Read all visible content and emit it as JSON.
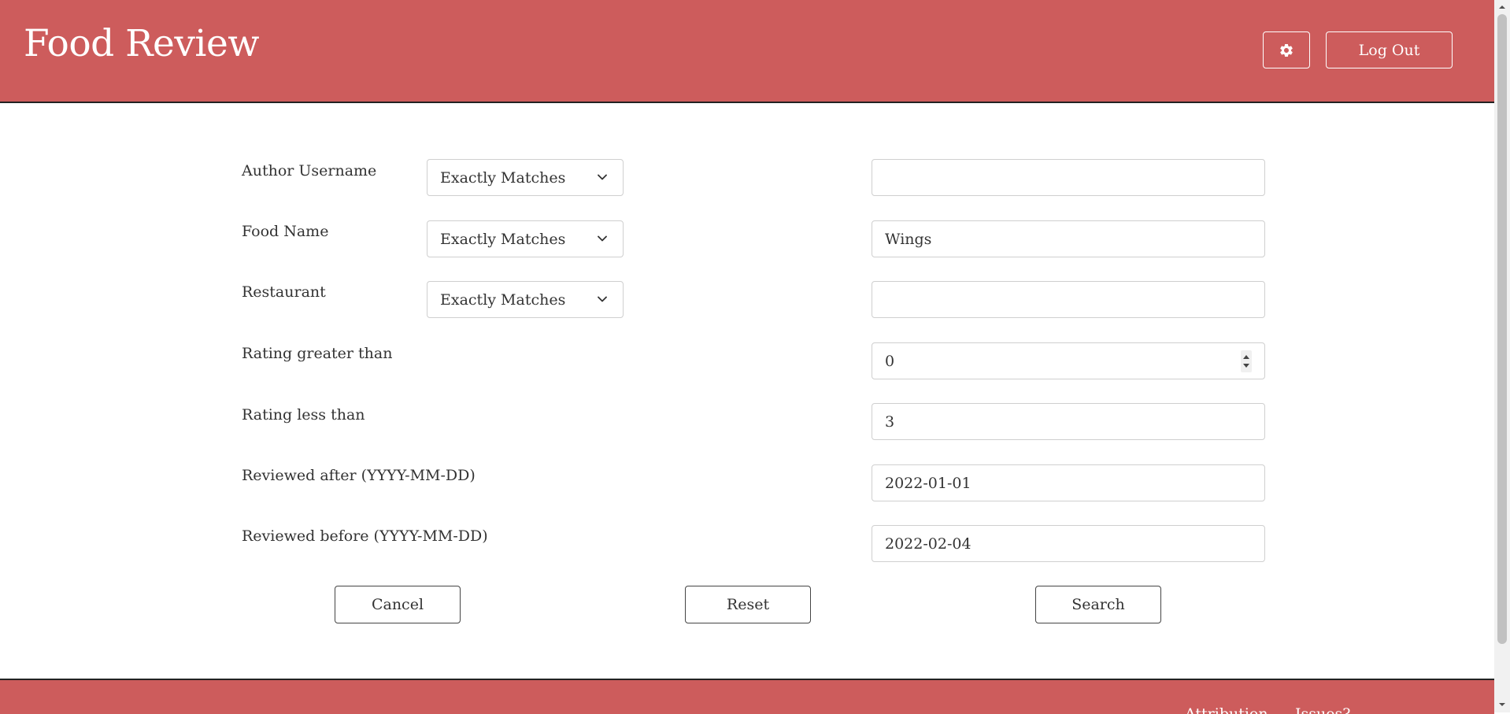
{
  "header": {
    "title": "Food Review",
    "settings_icon": "gear-icon",
    "logout_label": "Log Out"
  },
  "form": {
    "author_username": {
      "label": "Author Username",
      "match_mode": "Exactly Matches",
      "value": ""
    },
    "food_name": {
      "label": "Food Name",
      "match_mode": "Exactly Matches",
      "value": "Wings"
    },
    "restaurant": {
      "label": "Restaurant",
      "match_mode": "Exactly Matches",
      "value": ""
    },
    "rating_greater_than": {
      "label": "Rating greater than",
      "value": "0"
    },
    "rating_less_than": {
      "label": "Rating less than",
      "value": "3"
    },
    "reviewed_after": {
      "label": "Reviewed after (YYYY-MM-DD)",
      "value": "2022-01-01"
    },
    "reviewed_before": {
      "label": "Reviewed before (YYYY-MM-DD)",
      "value": "2022-02-04"
    }
  },
  "actions": {
    "cancel_label": "Cancel",
    "reset_label": "Reset",
    "search_label": "Search"
  },
  "footer": {
    "links": [
      "Attribution",
      "Issues?"
    ]
  },
  "colors": {
    "brand": "#cd5c5c",
    "header_text": "#ffffff",
    "border": "#cfcfcf"
  }
}
